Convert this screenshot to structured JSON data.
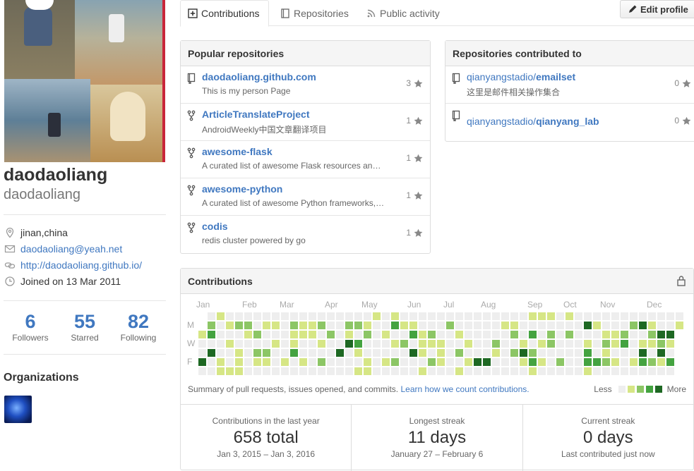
{
  "profile": {
    "username": "daodaoliang",
    "fullname": "daodaoliang",
    "location": "jinan,china",
    "email": "daodaoliang@yeah.net",
    "website": "http://daodaoliang.github.io/",
    "joined": "Joined on 13 Mar 2011",
    "stats": [
      {
        "num": "6",
        "label": "Followers"
      },
      {
        "num": "55",
        "label": "Starred"
      },
      {
        "num": "82",
        "label": "Following"
      }
    ],
    "organizations_title": "Organizations"
  },
  "tabs": [
    {
      "label": "Contributions",
      "icon": "plus-square-icon"
    },
    {
      "label": "Repositories",
      "icon": "book-icon"
    },
    {
      "label": "Public activity",
      "icon": "rss-icon"
    }
  ],
  "edit_profile": "Edit profile",
  "popular": {
    "title": "Popular repositories",
    "repos": [
      {
        "name": "daodaoliang.github.com",
        "desc": "This is my person Page",
        "stars": "3",
        "icon": "repo-icon"
      },
      {
        "name": "ArticleTranslateProject",
        "desc": "AndroidWeekly中国文章翻译项目",
        "stars": "1",
        "icon": "fork-icon"
      },
      {
        "name": "awesome-flask",
        "desc": "A curated list of awesome Flask resources an…",
        "stars": "1",
        "icon": "fork-icon"
      },
      {
        "name": "awesome-python",
        "desc": "A curated list of awesome Python frameworks,…",
        "stars": "1",
        "icon": "fork-icon"
      },
      {
        "name": "codis",
        "desc": "redis cluster powered by go",
        "stars": "1",
        "icon": "fork-icon"
      }
    ]
  },
  "contributed": {
    "title": "Repositories contributed to",
    "repos": [
      {
        "owner": "qianyangstadio/",
        "name": "emailset",
        "desc": "这里是邮件相关操作集合",
        "stars": "0"
      },
      {
        "owner": "qianyangstadio/",
        "name": "qianyang_lab",
        "desc": "",
        "stars": "0"
      }
    ]
  },
  "contributions": {
    "title": "Contributions",
    "months": [
      "Jan",
      "Feb",
      "Mar",
      "Apr",
      "May",
      "Jun",
      "Jul",
      "Aug",
      "Sep",
      "Oct",
      "Nov",
      "Dec"
    ],
    "day_labels": [
      "M",
      "W",
      "F"
    ],
    "summary": "Summary of pull requests, issues opened, and commits.",
    "learn_link": "Learn how we count contributions.",
    "legend_less": "Less",
    "legend_more": "More",
    "colors": [
      "#eeeeee",
      "#d6e685",
      "#8cc665",
      "#44a340",
      "#1e6823"
    ],
    "stats": [
      {
        "title": "Contributions in the last year",
        "value": "658 total",
        "sub": "Jan 3, 2015 – Jan 3, 2016"
      },
      {
        "title": "Longest streak",
        "value": "11 days",
        "sub": "January 27 – February 6"
      },
      {
        "title": "Current streak",
        "value": "0 days",
        "sub": "Last contributed just now"
      }
    ]
  }
}
